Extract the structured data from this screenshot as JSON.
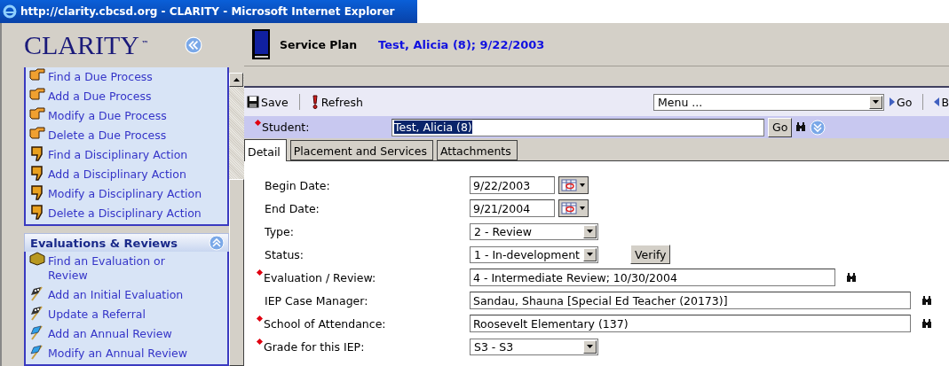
{
  "window": {
    "title": "http://clarity.cbcsd.org - CLARITY - Microsoft Internet Explorer"
  },
  "sidebar": {
    "logo": "CLARITY",
    "logo_mark": "™",
    "items": [
      {
        "label": "Find a Due Process",
        "kind": "hand"
      },
      {
        "label": "Add a Due Process",
        "kind": "hand"
      },
      {
        "label": "Modify a Due Process",
        "kind": "hand"
      },
      {
        "label": "Delete a Due Process",
        "kind": "hand"
      },
      {
        "label": "Find a Disciplinary Action",
        "kind": "thumb"
      },
      {
        "label": "Add a Disciplinary Action",
        "kind": "thumb"
      },
      {
        "label": "Modify a Disciplinary Action",
        "kind": "thumb"
      },
      {
        "label": "Delete a Disciplinary Action",
        "kind": "thumb"
      }
    ],
    "section": {
      "title": "Evaluations & Reviews",
      "expanded": true,
      "items": [
        {
          "label": "Find an Evaluation or Review",
          "kind": "box"
        },
        {
          "label": "Add an Initial Evaluation",
          "kind": "checkered-flag"
        },
        {
          "label": "Update a Referral",
          "kind": "checkered-flag"
        },
        {
          "label": "Add an Annual Review",
          "kind": "blue-flag"
        },
        {
          "label": "Modify an Annual Review",
          "kind": "blue-flag"
        }
      ]
    }
  },
  "header": {
    "title": "Service Plan",
    "subtitle": "Test, Alicia (8); 9/22/2003"
  },
  "toolbar": {
    "save": "Save",
    "refresh": "Refresh",
    "menu": "Menu ...",
    "go": "Go",
    "back": "B"
  },
  "student": {
    "label": "Student:",
    "required": true,
    "value": "Test, Alicia (8)",
    "go": "Go"
  },
  "tabs": [
    {
      "label": "Detail",
      "selected": true
    },
    {
      "label": "Placement and Services",
      "selected": false
    },
    {
      "label": "Attachments",
      "selected": false
    }
  ],
  "fields": [
    {
      "label": "Begin Date:",
      "required": false,
      "kind": "date",
      "value": "9/22/2003"
    },
    {
      "label": "End Date:",
      "required": false,
      "kind": "date",
      "value": "9/21/2004"
    },
    {
      "label": "Type:",
      "required": false,
      "kind": "select",
      "value": "2 - Review"
    },
    {
      "label": "Status:",
      "required": false,
      "kind": "select",
      "value": "1 - In-development",
      "button": "Verify"
    },
    {
      "label": "Evaluation / Review:",
      "required": true,
      "kind": "text",
      "value": "4 - Intermediate Review; 10/30/2004",
      "lookup": true
    },
    {
      "label": "IEP Case Manager:",
      "required": false,
      "kind": "wide-text",
      "value": "Sandau, Shauna [Special Ed Teacher (20173)]",
      "lookup": true
    },
    {
      "label": "School of Attendance:",
      "required": true,
      "kind": "wide-text",
      "value": "Roosevelt Elementary (137)",
      "lookup": true
    },
    {
      "label": "Grade for this IEP:",
      "required": true,
      "kind": "select",
      "value": "S3 - S3"
    }
  ]
}
